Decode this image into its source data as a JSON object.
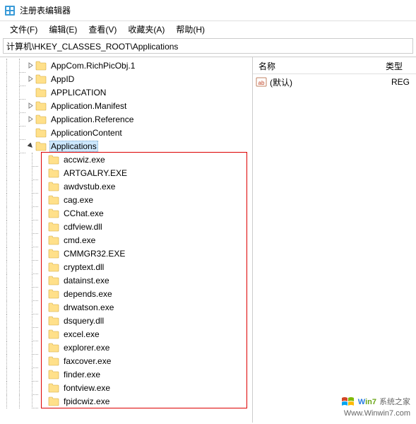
{
  "window": {
    "title": "注册表编辑器"
  },
  "menus": {
    "file": "文件(F)",
    "edit": "编辑(E)",
    "view": "查看(V)",
    "favorites": "收藏夹(A)",
    "help": "帮助(H)"
  },
  "address": "计算机\\HKEY_CLASSES_ROOT\\Applications",
  "tree": {
    "root_indent": 2,
    "siblings": [
      {
        "label": "AppCom.RichPicObj.1",
        "expandable": true
      },
      {
        "label": "AppID",
        "expandable": true
      },
      {
        "label": "APPLICATION",
        "expandable": false
      },
      {
        "label": "Application.Manifest",
        "expandable": true
      },
      {
        "label": "Application.Reference",
        "expandable": true
      },
      {
        "label": "ApplicationContent",
        "expandable": false
      }
    ],
    "selected": {
      "label": "Applications",
      "expandable": true,
      "open": true
    },
    "children": [
      {
        "label": "accwiz.exe"
      },
      {
        "label": "ARTGALRY.EXE"
      },
      {
        "label": "awdvstub.exe"
      },
      {
        "label": "cag.exe"
      },
      {
        "label": "CChat.exe"
      },
      {
        "label": "cdfview.dll"
      },
      {
        "label": "cmd.exe"
      },
      {
        "label": "CMMGR32.EXE"
      },
      {
        "label": "cryptext.dll"
      },
      {
        "label": "datainst.exe"
      },
      {
        "label": "depends.exe"
      },
      {
        "label": "drwatson.exe"
      },
      {
        "label": "dsquery.dll"
      },
      {
        "label": "excel.exe"
      },
      {
        "label": "explorer.exe"
      },
      {
        "label": "faxcover.exe"
      },
      {
        "label": "finder.exe"
      },
      {
        "label": "fontview.exe"
      },
      {
        "label": "fpidcwiz.exe"
      }
    ]
  },
  "list": {
    "cols": {
      "name": "名称",
      "type": "类型"
    },
    "rows": [
      {
        "name": "(默认)",
        "type": "REG"
      }
    ]
  },
  "watermark": {
    "line1_a": "W",
    "line1_b": "in7",
    "line1_c": "系统之家",
    "line2": "Www.Winwin7.com"
  }
}
